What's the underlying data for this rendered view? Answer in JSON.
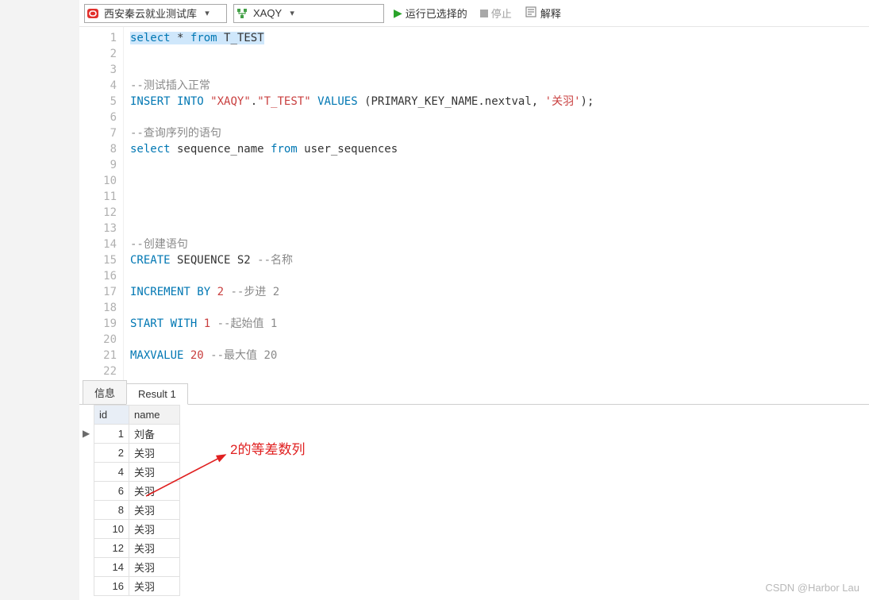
{
  "toolbar": {
    "db": {
      "icon": "oracle-icon",
      "label": "西安秦云就业测试库"
    },
    "schema": {
      "icon": "schema-icon",
      "label": "XAQY"
    },
    "run": "运行已选择的",
    "stop": "停止",
    "explain": "解释"
  },
  "editor": {
    "lines": [
      {
        "n": 1,
        "tokens": [
          {
            "t": "select",
            "c": "kw hl"
          },
          {
            "t": " ",
            "c": "hl"
          },
          {
            "t": "*",
            "c": "id hl"
          },
          {
            "t": " ",
            "c": "hl"
          },
          {
            "t": "from",
            "c": "kw hl"
          },
          {
            "t": " ",
            "c": "hl"
          },
          {
            "t": "T_TEST",
            "c": "id hl"
          }
        ]
      },
      {
        "n": 2,
        "tokens": []
      },
      {
        "n": 3,
        "tokens": []
      },
      {
        "n": 4,
        "tokens": [
          {
            "t": "--测试插入正常",
            "c": "cmt"
          }
        ]
      },
      {
        "n": 5,
        "tokens": [
          {
            "t": "INSERT",
            "c": "kw"
          },
          {
            "t": " ",
            "c": "id"
          },
          {
            "t": "INTO",
            "c": "kw"
          },
          {
            "t": " ",
            "c": "id"
          },
          {
            "t": "\"XAQY\"",
            "c": "str"
          },
          {
            "t": ".",
            "c": "id"
          },
          {
            "t": "\"T_TEST\"",
            "c": "str"
          },
          {
            "t": " ",
            "c": "id"
          },
          {
            "t": "VALUES",
            "c": "kw"
          },
          {
            "t": " (PRIMARY_KEY_NAME.nextval, ",
            "c": "id"
          },
          {
            "t": "'关羽'",
            "c": "str"
          },
          {
            "t": ");",
            "c": "id"
          }
        ]
      },
      {
        "n": 6,
        "tokens": []
      },
      {
        "n": 7,
        "tokens": [
          {
            "t": "--查询序列的语句",
            "c": "cmt"
          }
        ]
      },
      {
        "n": 8,
        "tokens": [
          {
            "t": "select",
            "c": "kw"
          },
          {
            "t": " sequence_name ",
            "c": "id"
          },
          {
            "t": "from",
            "c": "kw"
          },
          {
            "t": " user_sequences",
            "c": "id"
          }
        ]
      },
      {
        "n": 9,
        "tokens": []
      },
      {
        "n": 10,
        "tokens": []
      },
      {
        "n": 11,
        "tokens": []
      },
      {
        "n": 12,
        "tokens": []
      },
      {
        "n": 13,
        "tokens": []
      },
      {
        "n": 14,
        "tokens": [
          {
            "t": "--创建语句",
            "c": "cmt"
          }
        ]
      },
      {
        "n": 15,
        "tokens": [
          {
            "t": "CREATE",
            "c": "kw"
          },
          {
            "t": " SEQUENCE S2 ",
            "c": "id"
          },
          {
            "t": "--名称",
            "c": "cmt"
          }
        ]
      },
      {
        "n": 16,
        "tokens": []
      },
      {
        "n": 17,
        "tokens": [
          {
            "t": "INCREMENT",
            "c": "kw"
          },
          {
            "t": " ",
            "c": "id"
          },
          {
            "t": "BY",
            "c": "kw"
          },
          {
            "t": " ",
            "c": "id"
          },
          {
            "t": "2",
            "c": "num"
          },
          {
            "t": " ",
            "c": "id"
          },
          {
            "t": "--步进 2",
            "c": "cmt"
          }
        ]
      },
      {
        "n": 18,
        "tokens": []
      },
      {
        "n": 19,
        "tokens": [
          {
            "t": "START",
            "c": "kw"
          },
          {
            "t": " ",
            "c": "id"
          },
          {
            "t": "WITH",
            "c": "kw"
          },
          {
            "t": " ",
            "c": "id"
          },
          {
            "t": "1",
            "c": "num"
          },
          {
            "t": " ",
            "c": "id"
          },
          {
            "t": "--起始值 1",
            "c": "cmt"
          }
        ]
      },
      {
        "n": 20,
        "tokens": []
      },
      {
        "n": 21,
        "tokens": [
          {
            "t": "MAXVALUE",
            "c": "kw"
          },
          {
            "t": " ",
            "c": "id"
          },
          {
            "t": "20",
            "c": "num"
          },
          {
            "t": " ",
            "c": "id"
          },
          {
            "t": "--最大值 20",
            "c": "cmt"
          }
        ]
      },
      {
        "n": 22,
        "tokens": []
      }
    ]
  },
  "tabs": {
    "info": "信息",
    "result1": "Result 1"
  },
  "result": {
    "columns": {
      "id": "id",
      "name": "name"
    },
    "rows": [
      {
        "id": "1",
        "name": "刘备"
      },
      {
        "id": "2",
        "name": "关羽"
      },
      {
        "id": "4",
        "name": "关羽"
      },
      {
        "id": "6",
        "name": "关羽"
      },
      {
        "id": "8",
        "name": "关羽"
      },
      {
        "id": "10",
        "name": "关羽"
      },
      {
        "id": "12",
        "name": "关羽"
      },
      {
        "id": "14",
        "name": "关羽"
      },
      {
        "id": "16",
        "name": "关羽"
      }
    ]
  },
  "annotation": "2的等差数列",
  "watermark": "CSDN @Harbor Lau"
}
